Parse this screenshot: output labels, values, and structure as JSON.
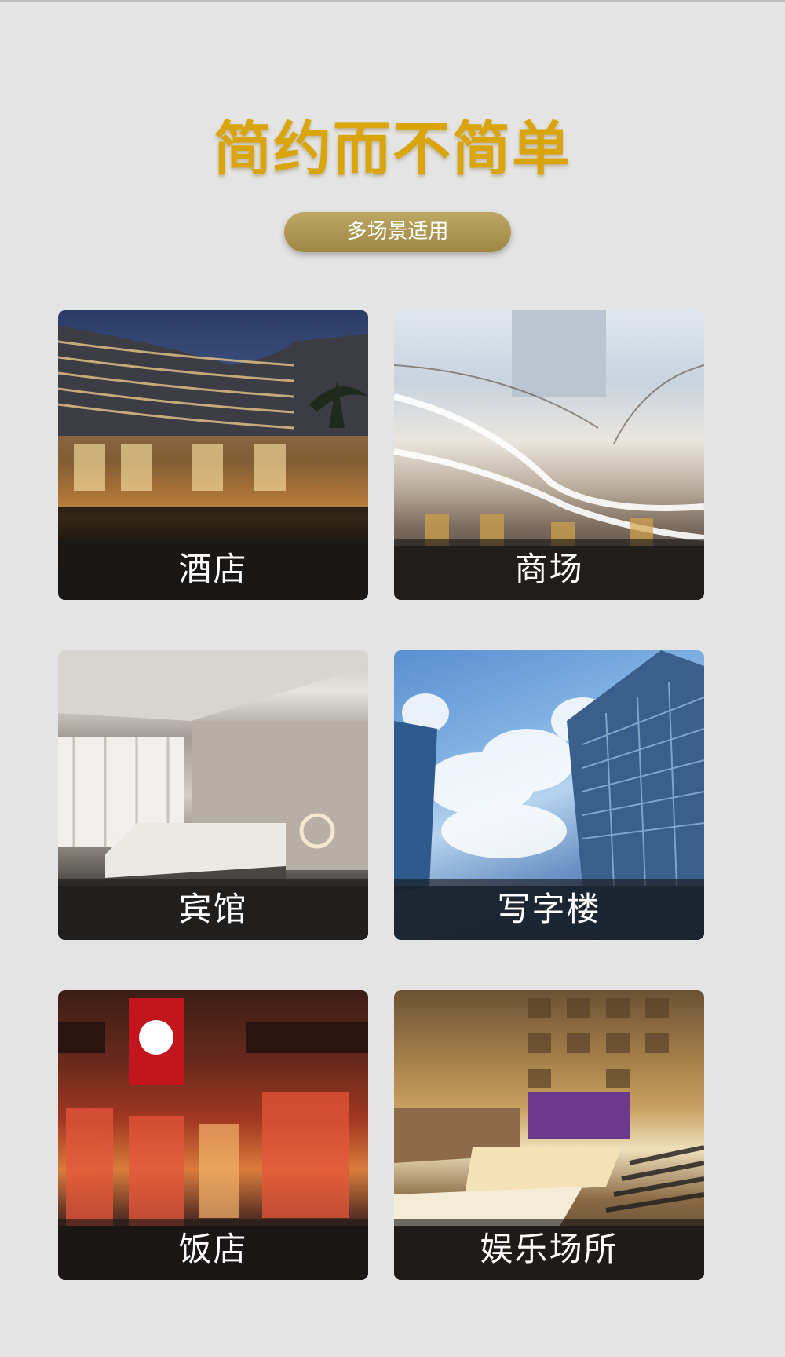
{
  "header": {
    "title": "简约而不简单",
    "subtitle": "多场景适用"
  },
  "scenes": [
    {
      "label": "酒店"
    },
    {
      "label": "商场"
    },
    {
      "label": "宾馆"
    },
    {
      "label": "写字楼"
    },
    {
      "label": "饭店"
    },
    {
      "label": "娱乐场所"
    }
  ]
}
